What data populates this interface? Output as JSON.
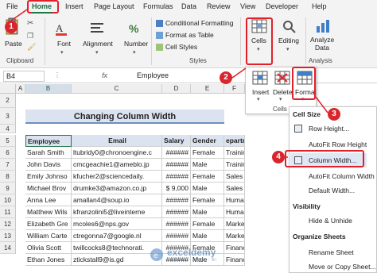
{
  "tabs": [
    "File",
    "Home",
    "Insert",
    "Page Layout",
    "Formulas",
    "Data",
    "Review",
    "View",
    "Developer",
    "Help"
  ],
  "ribbon": {
    "paste": "Paste",
    "clipboard": "Clipboard",
    "font": "Font",
    "alignment": "Alignment",
    "number": "Number",
    "conditional_formatting": "Conditional Formatting",
    "format_as_table": "Format as Table",
    "cell_styles": "Cell Styles",
    "styles": "Styles",
    "cells": "Cells",
    "editing": "Editing",
    "analyze": "Analyze",
    "data": "Data",
    "analysis": "Analysis",
    "insert": "Insert",
    "delete": "Delete",
    "format": "Format",
    "cells_group": "Cells"
  },
  "formula_bar": {
    "name_box": "B4",
    "fx": "fx",
    "value": "Employee"
  },
  "columns": [
    "A",
    "B",
    "C",
    "D",
    "E",
    "F"
  ],
  "rows": [
    "2",
    "3",
    "4",
    "5",
    "6",
    "7",
    "8",
    "9",
    "10",
    "11",
    "12",
    "13",
    "14"
  ],
  "sheet": {
    "title": "Changing Column Width",
    "headers": [
      "Employee",
      "Email",
      "Salary",
      "Gender",
      "epartment"
    ],
    "data": [
      [
        "Sarah Smith",
        "ltubridy0@chronoengine.c",
        "######",
        "Female",
        "Training"
      ],
      [
        "John Davis",
        "cmcgeachie1@ameblo.jp",
        "######",
        "Male",
        "Training"
      ],
      [
        "Emily Johnso",
        "kfucher2@sciencedaily.",
        "######",
        "Female",
        "Sales"
      ],
      [
        "Michael Brov",
        "drumke3@amazon.co.jp",
        "$ 9,000",
        "Male",
        "Sales"
      ],
      [
        "Anna Lee",
        "amallan4@soup.io",
        "######",
        "Female",
        "Human Resources"
      ],
      [
        "Matthew Wils",
        "kfranzolini5@liveinterne",
        "######",
        "Male",
        "Human Resources"
      ],
      [
        "Elizabeth Gre",
        "mcoles6@nps.gov",
        "######",
        "Female",
        "Marketing"
      ],
      [
        "William Carte",
        "ctregonna7@google.nl",
        "######",
        "Male",
        "Marketing"
      ],
      [
        "Olivia Scott",
        "twillcocks8@technorati.",
        "######",
        "Female",
        "Finance"
      ],
      [
        "Ethan Jones",
        "ztickstall9@is.gd",
        "######",
        "Male",
        "Finance"
      ]
    ]
  },
  "format_menu": {
    "cell_size": "Cell Size",
    "row_height": "Row Height...",
    "autofit_row_height": "AutoFit Row Height",
    "column_width": "Column Width...",
    "autofit_column_width": "AutoFit Column Width",
    "default_width": "Default Width...",
    "visibility": "Visibility",
    "hide_unhide": "Hide & Unhide",
    "organize_sheets": "Organize Sheets",
    "rename_sheet": "Rename Sheet",
    "move_copy_sheet": "Move or Copy Sheet..."
  },
  "steps": [
    "1",
    "2",
    "3",
    "4"
  ],
  "watermark": {
    "brand": "exceldemy",
    "tagline": "EXCEL · DATA · BI"
  },
  "colors": {
    "accent_red": "#e0212b",
    "excel_green": "#217346",
    "header_fill": "#dbe3f0",
    "selection": "#dfe7f5"
  }
}
